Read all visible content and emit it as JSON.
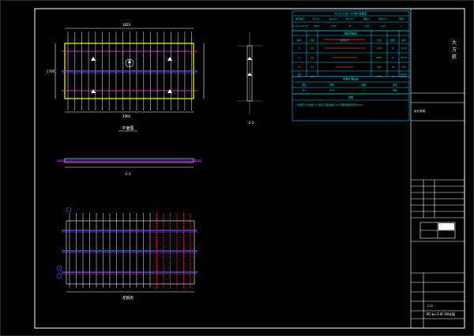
{
  "drawing": {
    "views": {
      "plan_label": "平面图",
      "section_a_label": "1-1",
      "section_b_label": "2-2",
      "rebar_label": "配筋图",
      "plan_dim_top": "3820",
      "plan_dim_side": "1700",
      "plan_dim_bottom": "3960"
    },
    "title_block": {
      "project_label": "大\n方\n航",
      "design_note_label": "设计说明",
      "drawing_number": "PC-bs-3-6F-09详图",
      "scale_label": "1:25"
    },
    "table_top": {
      "title": "PC-bs-3-6F-09 构件参数表",
      "headers": [
        "构件编号",
        "长(mm)",
        "宽(mm)",
        "厚(mm)",
        "重量(t)",
        "体积(m³)",
        "数量"
      ],
      "row": [
        "PC-bs-3-6F-09",
        "3820",
        "1700",
        "60",
        "0.95",
        "0.38",
        "1"
      ]
    },
    "table_rebar": {
      "title": "钢筋明细表",
      "headers": [
        "编号",
        "直径",
        "钢筋形状",
        "长度",
        "数量",
        "总长"
      ],
      "rows": [
        [
          "①",
          "C8",
          "1760",
          "1760",
          "19",
          "33.44"
        ],
        [
          "②",
          "C8",
          "3880",
          "3880",
          "12",
          "46.56"
        ],
        [
          "③",
          "C8",
          "200",
          "200",
          "16",
          "3.20"
        ],
        [
          "④",
          "C8",
          "300",
          "300",
          "8",
          "2.40"
        ]
      ],
      "total_label": "合计",
      "total_value": "85.60"
    },
    "table_mid": {
      "title": "预埋件明细表",
      "headers": [
        "编号",
        "规格",
        "数量",
        "备注"
      ],
      "rows": [
        [
          "M1",
          "Φ14",
          "4",
          "吊装"
        ],
        [
          "M2",
          "Φ12",
          "4",
          "支撑"
        ]
      ]
    },
    "table_bottom": {
      "title": "说明",
      "note": "1.本图尺寸以毫米计 2.混凝土强度等级C30 3.钢筋保护层厚度15mm"
    },
    "colors": {
      "background": "#000000",
      "outline": "#ffffff",
      "concrete": "#ffff00",
      "rebar": "#b0b0b0",
      "rebar_highlight": "#ff3030",
      "table_lines": "#00c8ff",
      "magenta": "#ff40ff",
      "blue": "#4060ff",
      "green": "#00ff40"
    },
    "icons": [
      "north-arrow-icon",
      "lifting-point-icon"
    ]
  }
}
